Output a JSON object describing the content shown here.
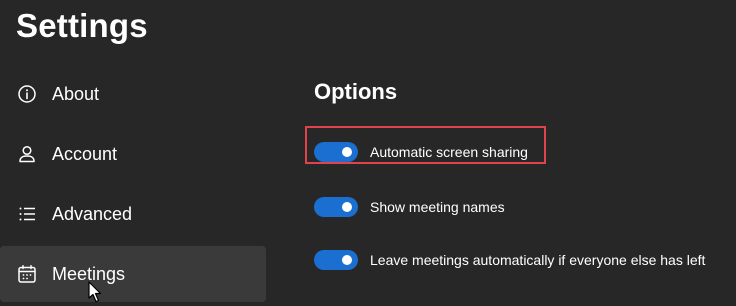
{
  "app": {
    "title": "Settings"
  },
  "sidebar": {
    "items": [
      {
        "label": "About",
        "icon": "info-icon",
        "selected": false
      },
      {
        "label": "Account",
        "icon": "account-icon",
        "selected": false
      },
      {
        "label": "Advanced",
        "icon": "list-icon",
        "selected": false
      },
      {
        "label": "Meetings",
        "icon": "calendar-icon",
        "selected": true
      }
    ]
  },
  "main": {
    "section_title": "Options",
    "options": [
      {
        "label": "Automatic screen sharing",
        "enabled": true,
        "highlighted": true
      },
      {
        "label": "Show meeting names",
        "enabled": true,
        "highlighted": false
      },
      {
        "label": "Leave meetings automatically if everyone else has left",
        "enabled": true,
        "highlighted": false
      }
    ]
  },
  "colors": {
    "background": "#272727",
    "selected_item": "#3a3a3a",
    "toggle_on": "#1b6fd0",
    "highlight": "#e0434b"
  }
}
